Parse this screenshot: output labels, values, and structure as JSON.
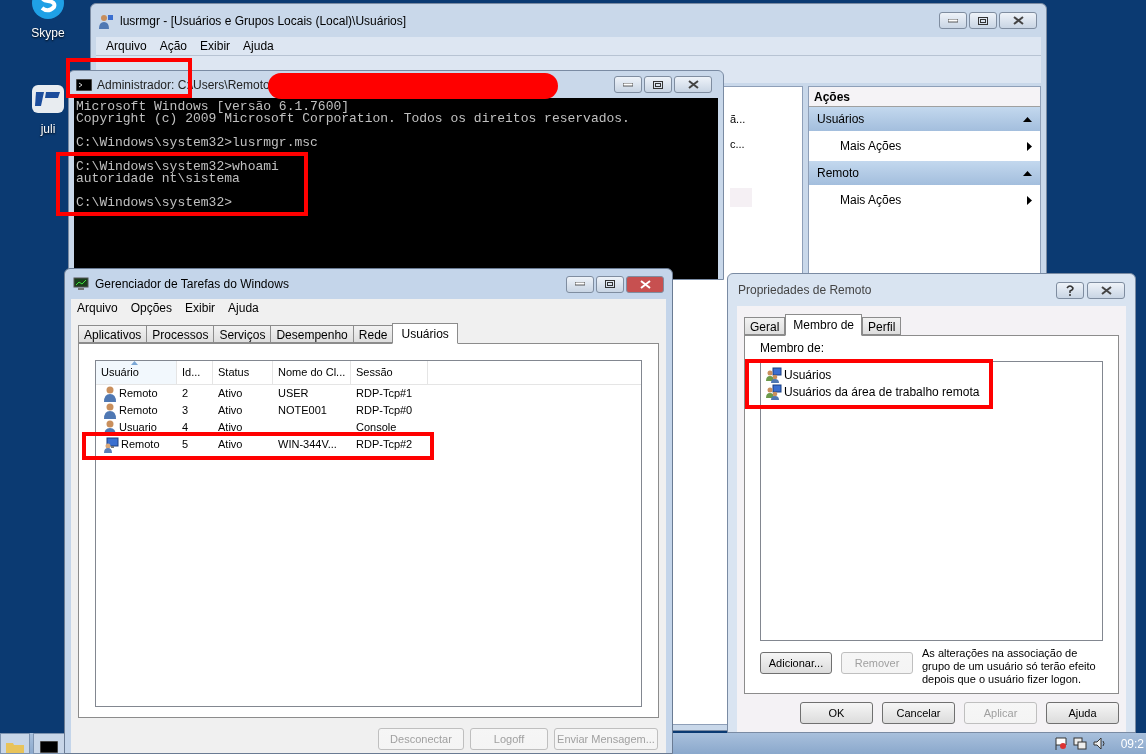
{
  "desktop_icons": [
    {
      "label": "Skype",
      "kind": "skype"
    },
    {
      "label": "juli",
      "kind": "lts"
    }
  ],
  "lusrmgr": {
    "title": "lusrmgr - [Usuários e Grupos Locais (Local)\\Usuários]",
    "menu": [
      "Arquivo",
      "Ação",
      "Exibir",
      "Ajuda"
    ],
    "list_cells": [
      "ã...",
      "c..."
    ],
    "actions": {
      "header": "Ações",
      "groups": [
        {
          "title": "Usuários",
          "expanded": true,
          "items": [
            "Mais Ações"
          ]
        },
        {
          "title": "Remoto",
          "expanded": true,
          "items": [
            "Mais Ações"
          ]
        }
      ]
    }
  },
  "cmd": {
    "title": "Administrador: C:\\Users\\Remoto",
    "blocks": [
      [
        "Microsoft Windows [versão 6.1.7600]",
        "Copyright (c) 2009 Microsoft Corporation. Todos os direitos reservados."
      ],
      [
        "C:\\Windows\\system32>lusrmgr.msc"
      ],
      [
        "C:\\Windows\\system32>whoami",
        "autoridade nt\\sistema"
      ],
      [
        "C:\\Windows\\system32>"
      ]
    ]
  },
  "task_manager": {
    "title": "Gerenciador de Tarefas do Windows",
    "menu": [
      "Arquivo",
      "Opções",
      "Exibir",
      "Ajuda"
    ],
    "tabs": [
      {
        "label": "Aplicativos",
        "selected": false
      },
      {
        "label": "Processos",
        "selected": false
      },
      {
        "label": "Serviços",
        "selected": false
      },
      {
        "label": "Desempenho",
        "selected": false
      },
      {
        "label": "Rede",
        "selected": false
      },
      {
        "label": "Usuários",
        "selected": true
      }
    ],
    "columns": [
      "Usuário",
      "Id...",
      "Status",
      "Nome do Cl...",
      "Sessão"
    ],
    "rows": [
      {
        "kind": "user",
        "cells": [
          "Remoto",
          "2",
          "Ativo",
          "USER",
          "RDP-Tcp#1"
        ]
      },
      {
        "kind": "user",
        "cells": [
          "Remoto",
          "3",
          "Ativo",
          "NOTE001",
          "RDP-Tcp#0"
        ]
      },
      {
        "kind": "user",
        "cells": [
          "Usuario",
          "4",
          "Ativo",
          "",
          "Console"
        ]
      },
      {
        "kind": "computer",
        "cells": [
          "Remoto",
          "5",
          "Ativo",
          "WIN-344V...",
          "RDP-Tcp#2"
        ]
      }
    ],
    "buttons": [
      {
        "label": "Desconectar",
        "disabled": true
      },
      {
        "label": "Logoff",
        "disabled": true
      },
      {
        "label": "Enviar Mensagem...",
        "disabled": true
      }
    ]
  },
  "properties": {
    "title": "Propriedades de Remoto",
    "tabs": [
      {
        "label": "Geral",
        "selected": false
      },
      {
        "label": "Membro de",
        "selected": true
      },
      {
        "label": "Perfil",
        "selected": false
      }
    ],
    "list_label": "Membro de:",
    "groups": [
      "Usuários",
      "Usuários da área de trabalho remota"
    ],
    "buttons": [
      {
        "label": "Adicionar...",
        "disabled": false
      },
      {
        "label": "Remover",
        "disabled": true
      }
    ],
    "note": "As alterações na associação de grupo de um usuário só terão efeito depois que o usuário fizer logon.",
    "dialog_buttons": [
      {
        "label": "OK",
        "disabled": false
      },
      {
        "label": "Cancelar",
        "disabled": false
      },
      {
        "label": "Aplicar",
        "disabled": true
      },
      {
        "label": "Ajuda",
        "disabled": false
      }
    ]
  },
  "taskbar": {
    "clock": "09:2"
  }
}
